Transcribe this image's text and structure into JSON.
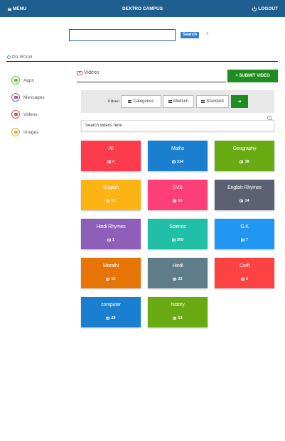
{
  "header": {
    "menu_label": "MENU",
    "app_title": "DEXTRO CAMPUS",
    "logout_label": "LOGOUT",
    "bar_color": "#1f5f8f"
  },
  "search": {
    "value": "",
    "placeholder": "",
    "button_label": "Search",
    "clear_label": "x"
  },
  "room": {
    "label": "Dr-Room"
  },
  "sidebar": {
    "items": [
      {
        "label": "Apps",
        "icon": "apps-icon",
        "color": "#6cbf3b"
      },
      {
        "label": "Messages",
        "icon": "messages-icon",
        "color": "#9b59b6"
      },
      {
        "label": "Videos",
        "icon": "videos-icon",
        "color": "#d9534f"
      },
      {
        "label": "Images",
        "icon": "images-icon",
        "color": "#f0a92e"
      }
    ]
  },
  "videos": {
    "heading": "Videos",
    "submit_label": "+ SUBMIT VIDEO",
    "filter_label": "Filter:",
    "filters": [
      "Categories",
      "Medium",
      "Standard"
    ],
    "go_label": "➜",
    "search_placeholder": "Search videos here"
  },
  "categories": [
    {
      "name": "All",
      "count": "4",
      "color": "#fc3c4c"
    },
    {
      "name": "Maths",
      "count": "314",
      "color": "#1a7fce"
    },
    {
      "name": "Geography",
      "count": "38",
      "color": "#6aaa12"
    },
    {
      "name": "English",
      "count": "72",
      "color": "#fcb415"
    },
    {
      "name": "EVS",
      "count": "60",
      "color": "#fc3f78"
    },
    {
      "name": "English Rhymes",
      "count": "14",
      "color": "#5c6072"
    },
    {
      "name": "Hindi Rhymes",
      "count": "1",
      "color": "#8d5fb8"
    },
    {
      "name": "Science",
      "count": "205",
      "color": "#22bfa8"
    },
    {
      "name": "G.K",
      "count": "7",
      "color": "#2196f3"
    },
    {
      "name": "Marathi",
      "count": "15",
      "color": "#e67505"
    },
    {
      "name": "Hindi",
      "count": "22",
      "color": "#5f7d89"
    },
    {
      "name": "Craft",
      "count": "4",
      "color": "#fc4242"
    },
    {
      "name": "computer",
      "count": "29",
      "color": "#1a7fce"
    },
    {
      "name": "history",
      "count": "53",
      "color": "#6aaa12"
    }
  ]
}
